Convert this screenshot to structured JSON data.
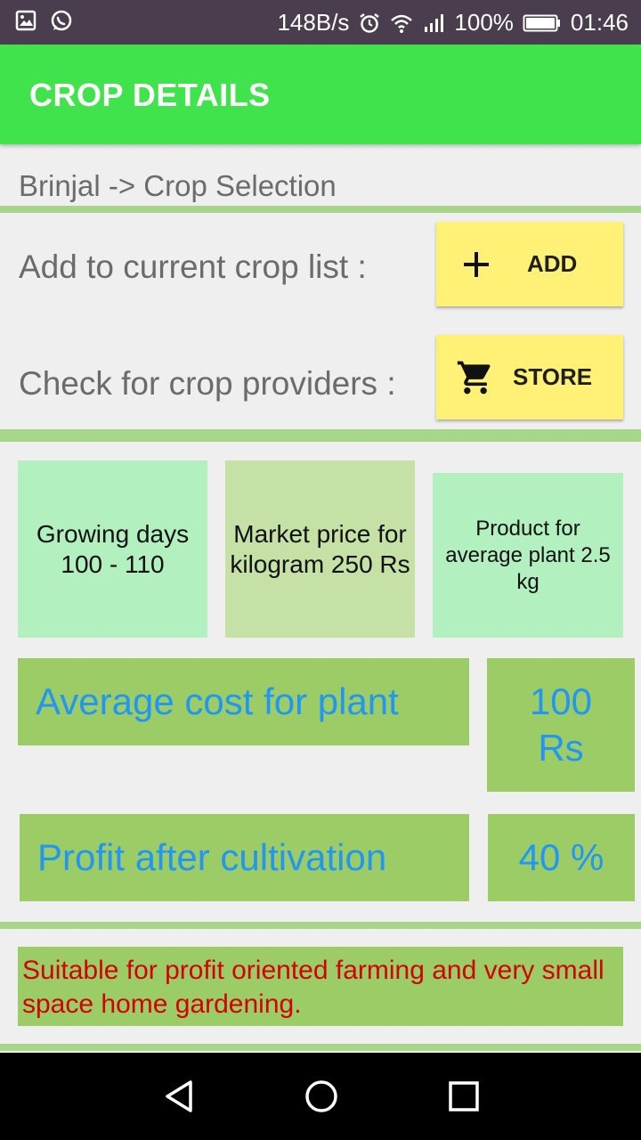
{
  "status_bar": {
    "net_speed": "148B/s",
    "battery": "100%",
    "time": "01:46"
  },
  "app_bar": {
    "title": "CROP DETAILS"
  },
  "breadcrumb": "Brinjal -> Crop Selection",
  "actions": {
    "add_label": "Add to current crop list :",
    "add_button": "ADD",
    "store_label": "Check for crop providers :",
    "store_button": "STORE"
  },
  "info_cards": {
    "growing_days": "Growing days 100 - 110",
    "market_price": "Market price for kilogram 250 Rs",
    "product": "Product for average plant 2.5 kg"
  },
  "stats": {
    "avg_cost_label": "Average cost for plant",
    "avg_cost_value": "100 Rs",
    "profit_label": "Profit after cultivation",
    "profit_value": "40 %"
  },
  "note": "Suitable for profit oriented farming and very small space home gardening.",
  "colors": {
    "app_bar": "#40e34b",
    "button": "#fff176",
    "stat_box": "#9ccc65",
    "stat_text": "#2196f3",
    "note_text": "#d50000",
    "divider": "#a7d68a"
  }
}
